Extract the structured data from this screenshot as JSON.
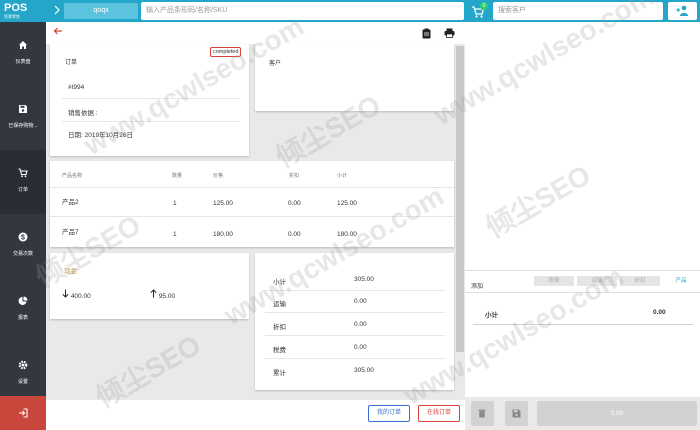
{
  "topbar": {
    "logo": "POS",
    "logo_sub": "智慧零售",
    "store_name": "qoqx",
    "product_search_placeholder": "输入产品条形码/名称/SKU",
    "cart_count": "0",
    "customer_search_placeholder": "搜索客户"
  },
  "sidebar": {
    "items": [
      {
        "label": "仪表盘",
        "icon": "home-icon"
      },
      {
        "label": "已保存购物...",
        "icon": "save-icon"
      },
      {
        "label": "订单",
        "icon": "cart-icon"
      },
      {
        "label": "交易次数",
        "icon": "dollar-icon"
      },
      {
        "label": "报表",
        "icon": "pie-chart-icon"
      },
      {
        "label": "设置",
        "icon": "gear-icon"
      }
    ],
    "logout_icon": "logout-icon"
  },
  "order": {
    "title": "订单",
    "status": "completed",
    "number": "#I994",
    "sales_basis": "销售依据 :",
    "date": "日期: 2019年10月26日"
  },
  "customer": {
    "title": "客户"
  },
  "items_table": {
    "headers": [
      "产品名称",
      "数量",
      "价格",
      "折扣",
      "小计"
    ],
    "rows": [
      [
        "产品2",
        "1",
        "125.00",
        "0.00",
        "125.00"
      ],
      [
        "产品7",
        "1",
        "180.00",
        "0.00",
        "180.00"
      ]
    ]
  },
  "payment": {
    "method": "现金",
    "paid": "400.00",
    "change": "95.00"
  },
  "totals": {
    "rows": [
      {
        "label": "小计",
        "value": "305.00"
      },
      {
        "label": "运输",
        "value": "0.00"
      },
      {
        "label": "折扣",
        "value": "0.00"
      },
      {
        "label": "税费",
        "value": "0.00"
      },
      {
        "label": "累计",
        "value": "305.00"
      }
    ]
  },
  "bottom_buttons": {
    "my_orders": "我的订单",
    "online_orders": "在线订单"
  },
  "right_panel": {
    "add_label": "添加",
    "tabs": [
      "税费",
      "运输",
      "折扣",
      "产品"
    ],
    "subtotal_label": "小计",
    "subtotal_value": "0.00",
    "pay_value": "0.00"
  },
  "watermark": {
    "text_a": "倾尘SEO",
    "text_b": "www.qcwlseo.com"
  },
  "colors": {
    "accent": "#23a6c9",
    "sidebar": "#333840",
    "danger": "#d9423a",
    "link": "#3a6fd1"
  }
}
